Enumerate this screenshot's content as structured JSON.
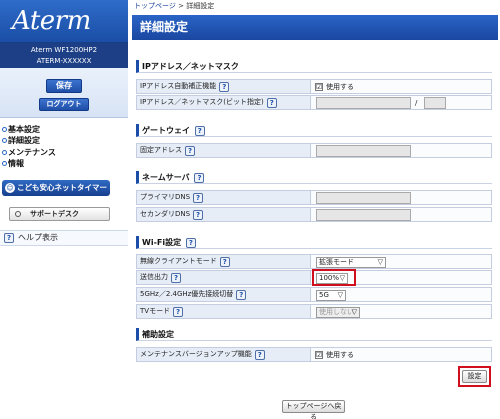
{
  "sidebar": {
    "logo": "Aterm",
    "model": "Aterm WF1200HP2",
    "serial": "ATERM-XXXXXX",
    "save_label": "保存",
    "logout_label": "ログアウト",
    "nav": [
      {
        "label": "基本設定"
      },
      {
        "label": "詳細設定"
      },
      {
        "label": "メンテナンス"
      },
      {
        "label": "情報"
      }
    ],
    "kids_label": "こども安心ネットタイマー",
    "support_label": "サポートデスク",
    "help_label": "ヘルプ表示"
  },
  "breadcrumb": {
    "home": "トップページ",
    "sep": " > ",
    "current": "詳細設定"
  },
  "title": "詳細設定",
  "help_glyph": "?",
  "sections": {
    "ip": {
      "title": "IPアドレス／ネットマスク",
      "auto_label": "IPアドレス自動補正機能",
      "auto_check": "☑",
      "auto_value": "使用する",
      "mask_label": "IPアドレス／ネットマスク(ビット指定)",
      "slash": "/"
    },
    "gateway": {
      "title": "ゲートウェイ",
      "fixed_label": "固定アドレス"
    },
    "dns": {
      "title": "ネームサーバ",
      "primary_label": "プライマリDNS",
      "secondary_label": "セカンダリDNS"
    },
    "wifi": {
      "title": "Wi-Fi設定",
      "client_label": "無線クライアントモード",
      "client_value": "拡張モード",
      "power_label": "送信出力",
      "power_value": "100%",
      "band_label": "5GHz／2.4GHz優先接続切替",
      "band_value": "5G",
      "tv_label": "TVモード",
      "tv_value": "使用しない"
    },
    "maint": {
      "title": "補助設定",
      "update_label": "メンテナンスバージョンアップ機能",
      "update_check": "☑",
      "update_value": "使用する"
    }
  },
  "buttons": {
    "setting": "設定",
    "back": "トップページへ戻る"
  },
  "icons": {
    "help": "question-mark-icon",
    "select_arrow": "▽"
  }
}
